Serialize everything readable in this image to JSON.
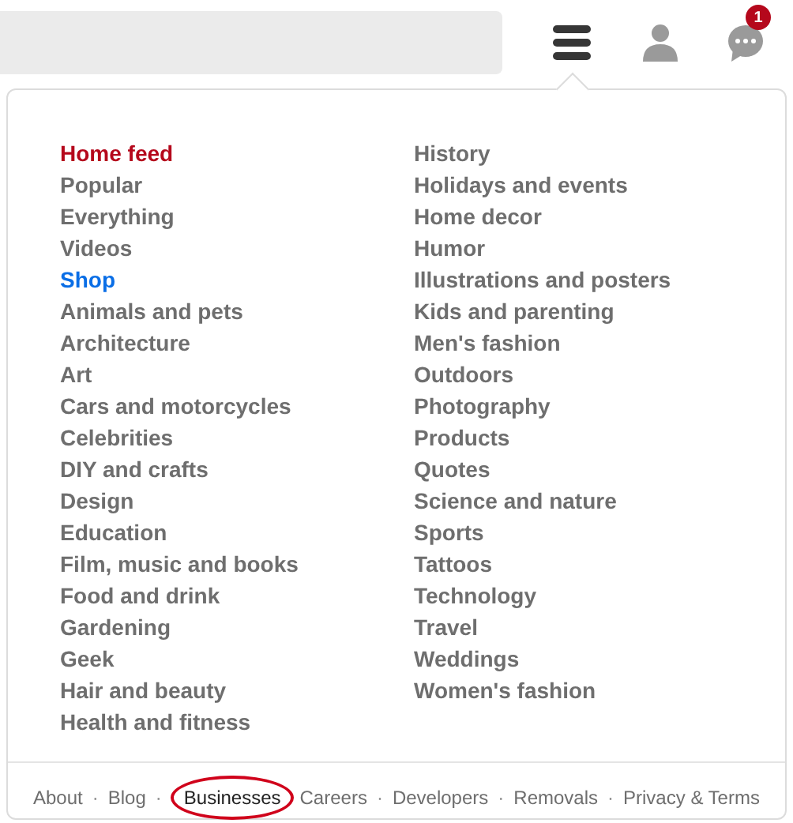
{
  "header": {
    "notification_count": "1"
  },
  "menu": {
    "columns": [
      [
        {
          "label": "Home feed",
          "kind": "featured"
        },
        {
          "label": "Popular",
          "kind": "normal"
        },
        {
          "label": "Everything",
          "kind": "normal"
        },
        {
          "label": "Videos",
          "kind": "normal"
        },
        {
          "label": "Shop",
          "kind": "shop"
        },
        {
          "label": "Animals and pets",
          "kind": "normal"
        },
        {
          "label": "Architecture",
          "kind": "normal"
        },
        {
          "label": "Art",
          "kind": "normal"
        },
        {
          "label": "Cars and motorcycles",
          "kind": "normal"
        },
        {
          "label": "Celebrities",
          "kind": "normal"
        },
        {
          "label": "DIY and crafts",
          "kind": "normal"
        },
        {
          "label": "Design",
          "kind": "normal"
        },
        {
          "label": "Education",
          "kind": "normal"
        },
        {
          "label": "Film, music and books",
          "kind": "normal"
        },
        {
          "label": "Food and drink",
          "kind": "normal"
        },
        {
          "label": "Gardening",
          "kind": "normal"
        },
        {
          "label": "Geek",
          "kind": "normal"
        },
        {
          "label": "Hair and beauty",
          "kind": "normal"
        },
        {
          "label": "Health and fitness",
          "kind": "normal"
        }
      ],
      [
        {
          "label": "History",
          "kind": "normal"
        },
        {
          "label": "Holidays and events",
          "kind": "normal"
        },
        {
          "label": "Home decor",
          "kind": "normal"
        },
        {
          "label": "Humor",
          "kind": "normal"
        },
        {
          "label": "Illustrations and posters",
          "kind": "normal"
        },
        {
          "label": "Kids and parenting",
          "kind": "normal"
        },
        {
          "label": "Men's fashion",
          "kind": "normal"
        },
        {
          "label": "Outdoors",
          "kind": "normal"
        },
        {
          "label": "Photography",
          "kind": "normal"
        },
        {
          "label": "Products",
          "kind": "normal"
        },
        {
          "label": "Quotes",
          "kind": "normal"
        },
        {
          "label": "Science and nature",
          "kind": "normal"
        },
        {
          "label": "Sports",
          "kind": "normal"
        },
        {
          "label": "Tattoos",
          "kind": "normal"
        },
        {
          "label": "Technology",
          "kind": "normal"
        },
        {
          "label": "Travel",
          "kind": "normal"
        },
        {
          "label": "Weddings",
          "kind": "normal"
        },
        {
          "label": "Women's fashion",
          "kind": "normal"
        }
      ]
    ]
  },
  "footer": [
    {
      "kind": "link",
      "label": "About",
      "circled": false
    },
    {
      "kind": "separator",
      "label": "·"
    },
    {
      "kind": "link",
      "label": "Blog",
      "circled": false
    },
    {
      "kind": "separator",
      "label": "·"
    },
    {
      "kind": "link",
      "label": "Businesses",
      "circled": true
    },
    {
      "kind": "link",
      "label": "Careers",
      "circled": false
    },
    {
      "kind": "separator",
      "label": "·"
    },
    {
      "kind": "link",
      "label": "Developers",
      "circled": false
    },
    {
      "kind": "separator",
      "label": "·"
    },
    {
      "kind": "link",
      "label": "Removals",
      "circled": false
    },
    {
      "kind": "separator",
      "label": "·"
    },
    {
      "kind": "link",
      "label": "Privacy & Terms",
      "circled": false
    }
  ]
}
